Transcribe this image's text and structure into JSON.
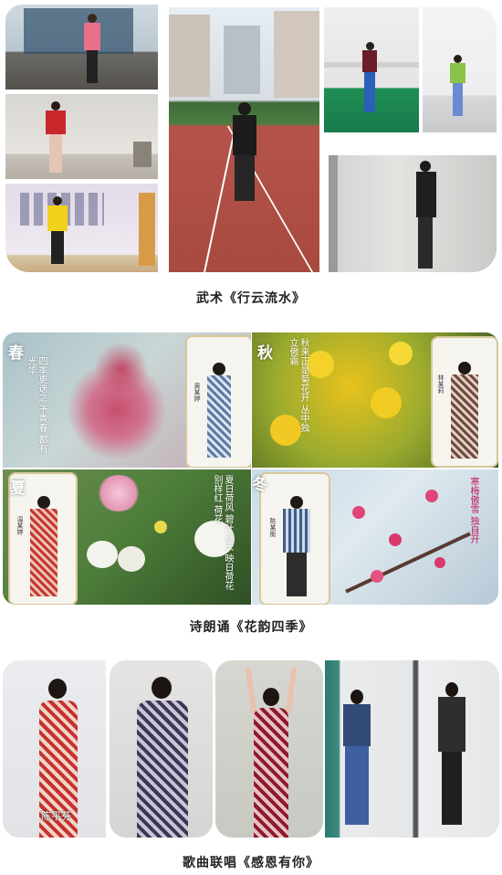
{
  "sections": [
    {
      "caption": "武术《行云流水》"
    },
    {
      "caption": "诗朗诵《花韵四季》"
    },
    {
      "caption": "歌曲联唱《感恩有你》"
    }
  ],
  "poem": {
    "spring": {
      "season": "春",
      "poem": "四季更迭之 予青春 都有光华",
      "name": "黄某婷"
    },
    "autumn": {
      "season": "秋",
      "poem": "秋来正是菊花开 丛中独立傲霜",
      "name": "林某莉"
    },
    "summer": {
      "season": "夏",
      "poem": "夏日荷风 碧叶连天 映日荷花 别样红 荷花",
      "name": "温某婷"
    },
    "winter": {
      "season": "冬",
      "poem": "寒梅傲雪 独自开",
      "name": "陈某衡"
    }
  },
  "singing": {
    "name_label": "陈平芬"
  },
  "colors": {
    "track": "#b5534a",
    "green_floor": "#1f8f55",
    "lotus_green": "#4e7d3a",
    "mum_yellow": "#e8c21d",
    "plum_pink": "#e0457a"
  }
}
